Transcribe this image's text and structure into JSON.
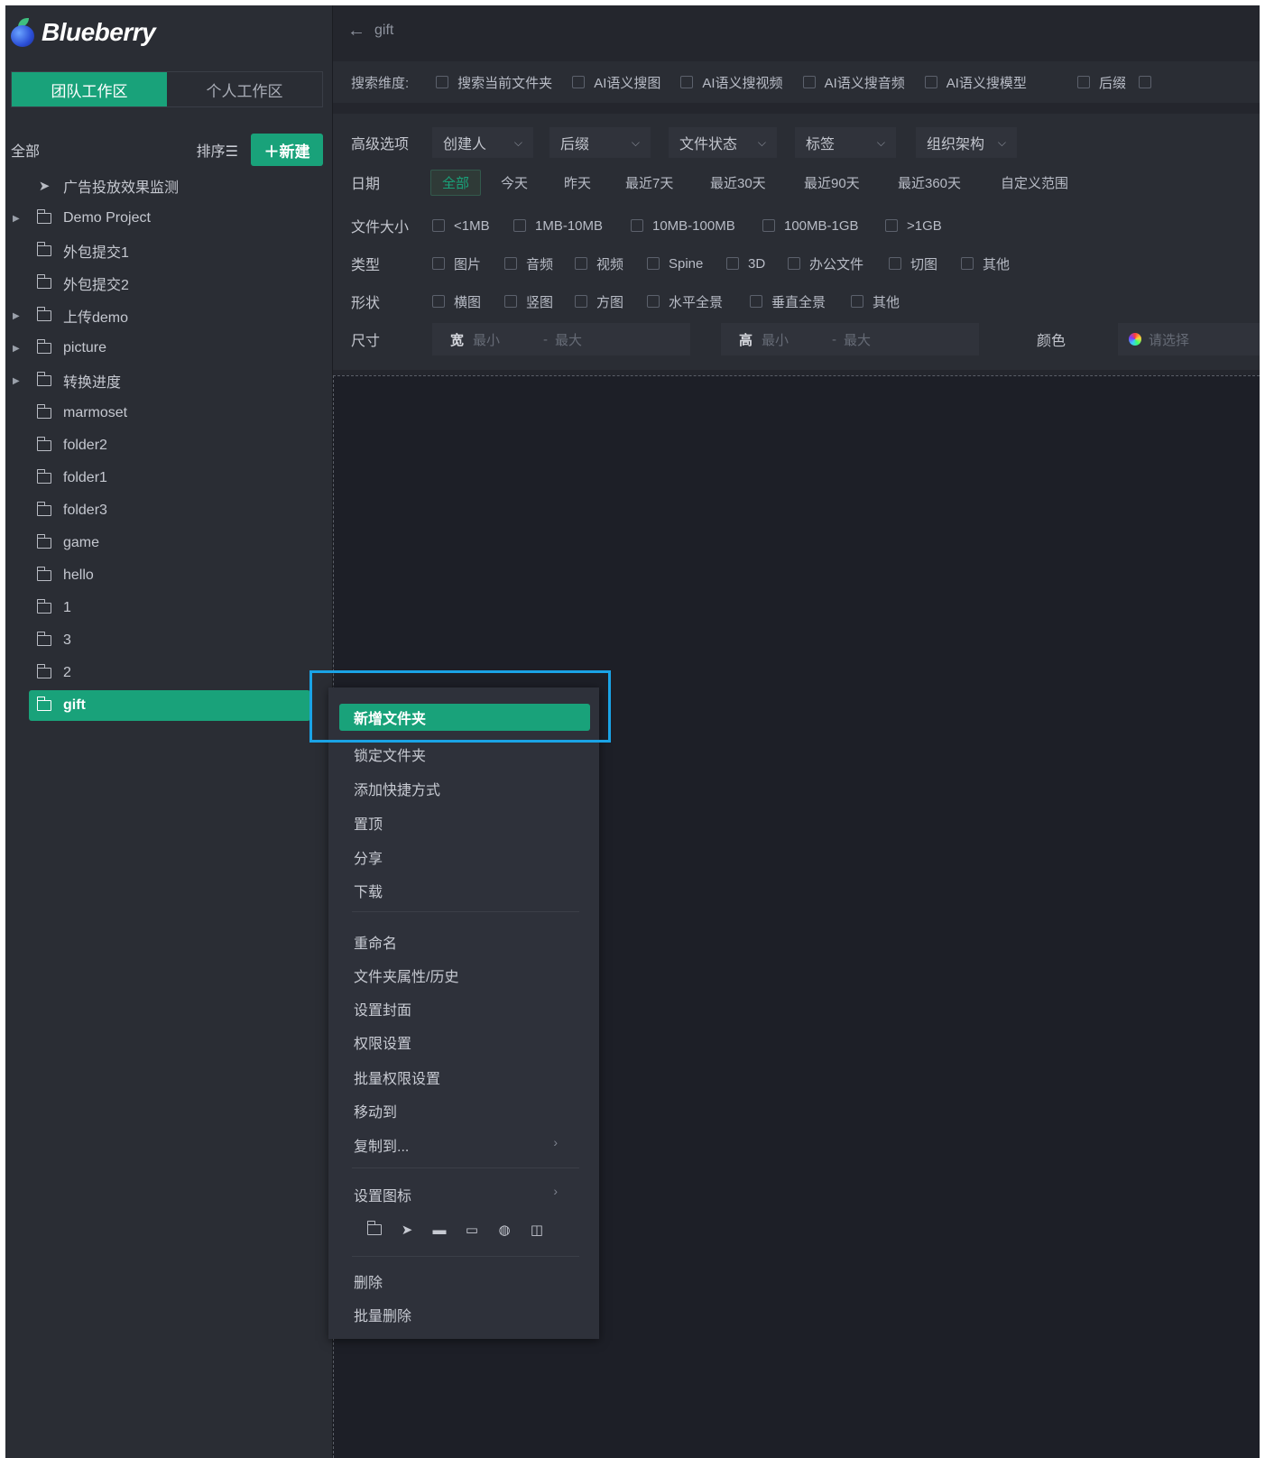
{
  "brand": {
    "name": "Blueberry"
  },
  "workspace_tabs": [
    "团队工作区",
    "个人工作区"
  ],
  "sidebar": {
    "all_label": "全部",
    "sort_label": "排序☰",
    "new_button": "＋新建",
    "items": [
      {
        "label": "广告投放效果监测",
        "icon": "send-icon",
        "expandable": false
      },
      {
        "label": "Demo Project",
        "icon": "folder-icon",
        "expandable": true
      },
      {
        "label": "外包提交1",
        "icon": "folder-icon",
        "expandable": false
      },
      {
        "label": "外包提交2",
        "icon": "folder-icon",
        "expandable": false
      },
      {
        "label": "上传demo",
        "icon": "folder-icon",
        "expandable": true
      },
      {
        "label": "picture",
        "icon": "folder-icon",
        "expandable": true
      },
      {
        "label": "转换进度",
        "icon": "folder-icon",
        "expandable": true
      },
      {
        "label": "marmoset",
        "icon": "folder-icon",
        "expandable": false
      },
      {
        "label": "folder2",
        "icon": "folder-icon",
        "expandable": false
      },
      {
        "label": "folder1",
        "icon": "folder-icon",
        "expandable": false
      },
      {
        "label": "folder3",
        "icon": "folder-icon",
        "expandable": false
      },
      {
        "label": "game",
        "icon": "folder-icon",
        "expandable": false
      },
      {
        "label": "hello",
        "icon": "folder-icon",
        "expandable": false
      },
      {
        "label": "1",
        "icon": "folder-icon",
        "expandable": false
      },
      {
        "label": "3",
        "icon": "folder-icon",
        "expandable": false
      },
      {
        "label": "2",
        "icon": "folder-icon",
        "expandable": false
      },
      {
        "label": "gift",
        "icon": "folder-icon",
        "expandable": false,
        "selected": true
      }
    ]
  },
  "topbar": {
    "back_icon": "arrow-left-icon",
    "title": "gift"
  },
  "search_scope": {
    "label": "搜索维度:",
    "options": [
      "搜索当前文件夹",
      "AI语义搜图",
      "AI语义搜视频",
      "AI语义搜音频",
      "AI语义搜模型",
      "后缀"
    ]
  },
  "filters": {
    "advanced_label": "高级选项",
    "dropdowns": [
      "创建人",
      "后缀",
      "文件状态",
      "标签",
      "组织架构"
    ],
    "date_label": "日期",
    "date_options": [
      "全部",
      "今天",
      "昨天",
      "最近7天",
      "最近30天",
      "最近90天",
      "最近360天",
      "自定义范围"
    ],
    "size_label": "文件大小",
    "size_options": [
      "<1MB",
      "1MB-10MB",
      "10MB-100MB",
      "100MB-1GB",
      ">1GB"
    ],
    "type_label": "类型",
    "type_options": [
      "图片",
      "音频",
      "视频",
      "Spine",
      "3D",
      "办公文件",
      "切图",
      "其他"
    ],
    "shape_label": "形状",
    "shape_options": [
      "横图",
      "竖图",
      "方图",
      "水平全景",
      "垂直全景",
      "其他"
    ],
    "dimension_label": "尺寸",
    "width_label": "宽",
    "height_label": "高",
    "min_placeholder": "最小",
    "max_placeholder": "最大",
    "dash": "-",
    "color_label": "颜色",
    "color_placeholder": "请选择"
  },
  "context_menu": {
    "items": [
      "新增文件夹",
      "锁定文件夹",
      "添加快捷方式",
      "置顶",
      "分享",
      "下载",
      "重命名",
      "文件夹属性/历史",
      "设置封面",
      "权限设置",
      "批量权限设置",
      "移动到",
      "复制到...",
      "设置图标",
      "删除",
      "批量删除"
    ],
    "icon_choices": [
      "folder-icon",
      "send-icon",
      "chat-icon",
      "video-icon",
      "globe-icon",
      "camera-icon"
    ]
  },
  "colors": {
    "accent": "#19a27a",
    "highlight": "#1aa3e6",
    "background": "#23252c"
  }
}
